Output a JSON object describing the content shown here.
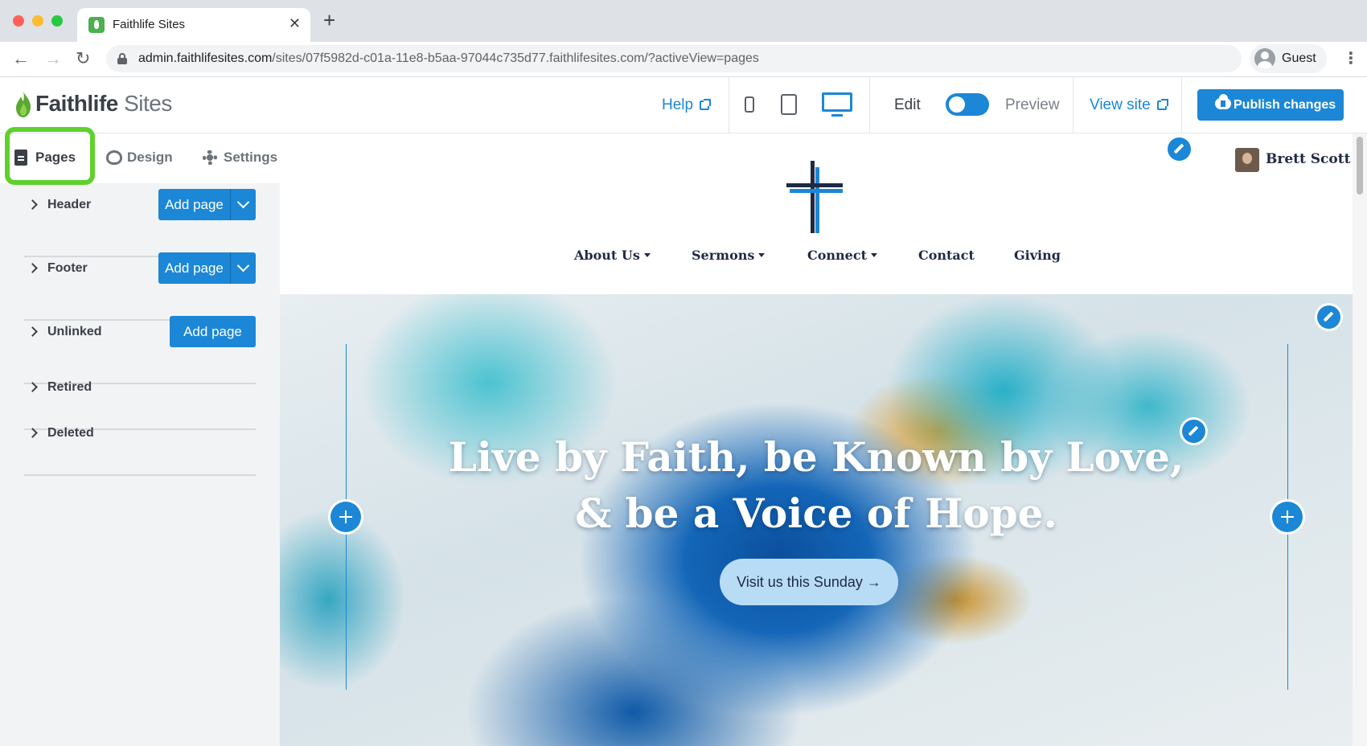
{
  "browser": {
    "tab_title": "Faithlife Sites",
    "tab_close": "✕",
    "new_tab": "+",
    "back": "←",
    "forward": "→",
    "reload": "↻",
    "url_host": "admin.faithlifesites.com",
    "url_path": "/sites/07f5982d-c01a-11e8-b5aa-97044c735d77.faithlifesites.com/?activeView=pages",
    "profile_label": "Guest",
    "menu": "⋮"
  },
  "app_header": {
    "logo_bold": "Faithlife",
    "logo_light": " Sites",
    "help_label": "Help",
    "edit_label": "Edit",
    "preview_label": "Preview",
    "view_site_label": "View site",
    "publish_label": "Publish changes",
    "mode_toggle_on": false,
    "active_device": "desktop"
  },
  "sidebar": {
    "tabs": [
      {
        "label": "Pages",
        "icon": "document-icon",
        "active": true
      },
      {
        "label": "Design",
        "icon": "palette-icon",
        "active": false
      },
      {
        "label": "Settings",
        "icon": "gear-icon",
        "active": false
      }
    ],
    "sections": [
      {
        "label": "Header",
        "add_label": "Add page",
        "has_menu": true
      },
      {
        "label": "Footer",
        "add_label": "Add page",
        "has_menu": true
      },
      {
        "label": "Unlinked",
        "add_label": "Add page",
        "has_menu": false
      },
      {
        "label": "Retired"
      },
      {
        "label": "Deleted"
      }
    ]
  },
  "site": {
    "user_name": "Brett Scott",
    "nav": [
      {
        "label": "About Us",
        "dropdown": true
      },
      {
        "label": "Sermons",
        "dropdown": true
      },
      {
        "label": "Connect",
        "dropdown": true
      },
      {
        "label": "Contact",
        "dropdown": false
      },
      {
        "label": "Giving",
        "dropdown": false
      }
    ],
    "hero_line1": "Live by Faith, be Known by Love,",
    "hero_line2": "& be a Voice of Hope.",
    "hero_cta": "Visit us this Sunday →"
  },
  "colors": {
    "accent": "#1b87d6",
    "highlight": "#5fd12b",
    "navy": "#1f2a44"
  }
}
